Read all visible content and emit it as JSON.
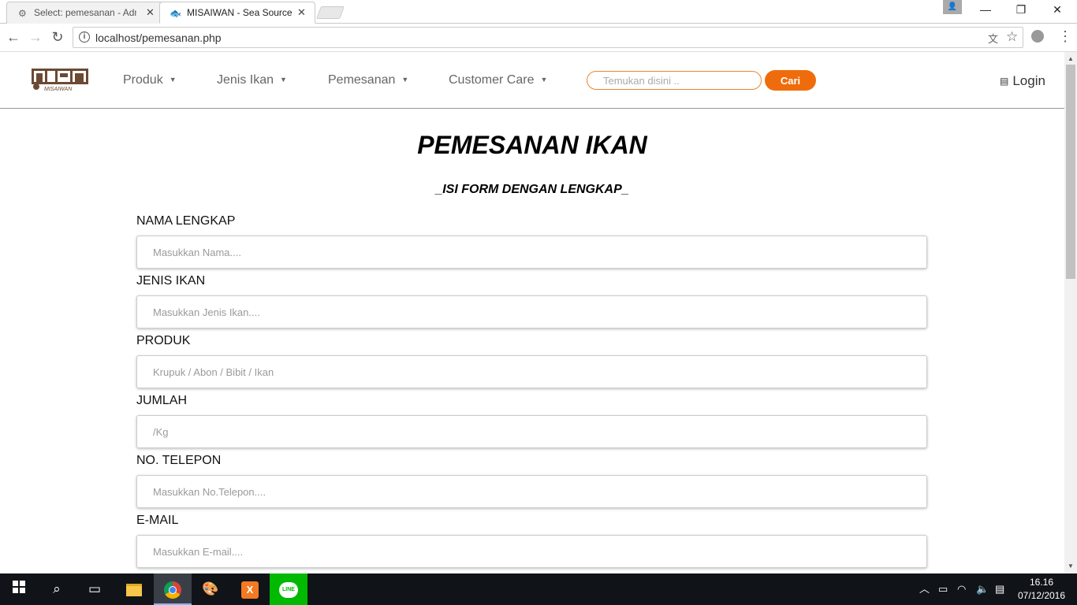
{
  "browser": {
    "tabs": [
      {
        "label": "Select: pemesanan - Adm",
        "active": false
      },
      {
        "label": "MISAIWAN - Sea Source",
        "active": true
      }
    ],
    "url": "localhost/pemesanan.php"
  },
  "header": {
    "logo_text": "MISAIWAN",
    "nav": [
      {
        "label": "Produk"
      },
      {
        "label": "Jenis Ikan"
      },
      {
        "label": "Pemesanan"
      },
      {
        "label": "Customer Care"
      }
    ],
    "search_placeholder": "Temukan disini ..",
    "search_button": "Cari",
    "login_label": "Login"
  },
  "form": {
    "title": "PEMESANAN IKAN",
    "subtitle": "_ISI FORM DENGAN LENGKAP_",
    "fields": [
      {
        "label": "NAMA LENGKAP",
        "placeholder": "Masukkan Nama...."
      },
      {
        "label": "JENIS IKAN",
        "placeholder": "Masukkan Jenis Ikan...."
      },
      {
        "label": "PRODUK",
        "placeholder": "Krupuk / Abon / Bibit / Ikan"
      },
      {
        "label": "JUMLAH",
        "placeholder": "/Kg"
      },
      {
        "label": "NO. TELEPON",
        "placeholder": "Masukkan No.Telepon...."
      },
      {
        "label": "E-MAIL",
        "placeholder": "Masukkan E-mail...."
      }
    ]
  },
  "taskbar": {
    "time": "16.16",
    "date": "07/12/2016",
    "line_label": "LINE"
  },
  "colors": {
    "accent": "#ef6c0c",
    "search_border": "#e8862a",
    "logo_brown": "#6b4a34"
  }
}
